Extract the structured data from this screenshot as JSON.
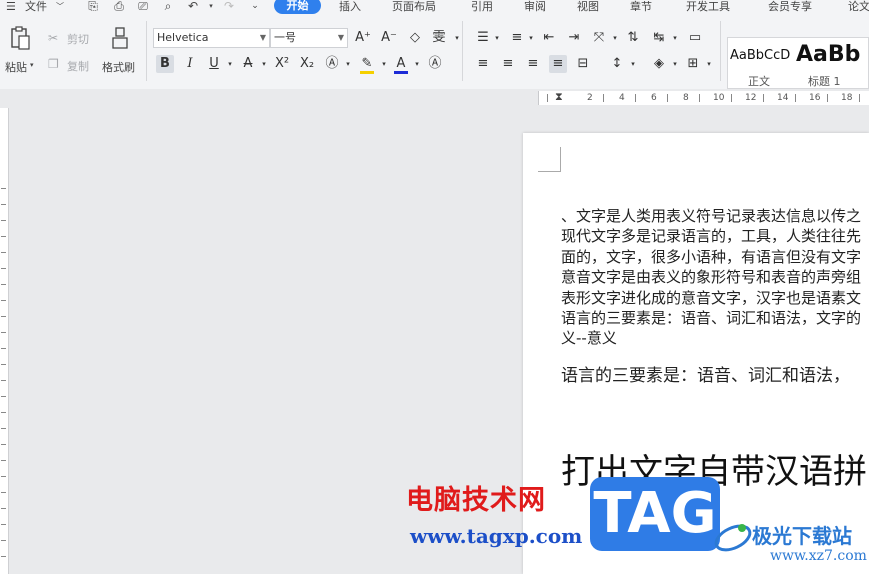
{
  "menu": {
    "file_label": "文件",
    "tabs": [
      {
        "label": "开始",
        "active": true
      },
      {
        "label": "插入"
      },
      {
        "label": "页面布局"
      },
      {
        "label": "引用"
      },
      {
        "label": "审阅"
      },
      {
        "label": "视图"
      },
      {
        "label": "章节"
      },
      {
        "label": "开发工具"
      },
      {
        "label": "会员专享"
      },
      {
        "label": "论文"
      }
    ]
  },
  "ribbon": {
    "paste_label": "粘贴",
    "cut_label": "剪切",
    "copy_label": "复制",
    "format_painter_label": "格式刷",
    "font_name": "Helvetica",
    "font_size": "一号",
    "styles": [
      {
        "preview": "AaBbCcD",
        "label": "正文"
      },
      {
        "preview": "AaBb",
        "label": "标题 1"
      }
    ]
  },
  "ruler": {
    "numbers": [
      "2",
      "4",
      "6",
      "8",
      "10",
      "12",
      "14",
      "16",
      "18"
    ]
  },
  "document": {
    "paragraph_lines": [
      "、文字是人类用表义符号记录表达信息以传之",
      "现代文字多是记录语言的，工具，人类往往先",
      "面的，文字，很多小语种，有语言但没有文字",
      "意音文字是由表义的象形符号和表音的声旁组",
      "表形文字进化成的意音文字，汉字也是语素文",
      "语言的三要素是：语音、词汇和语法，文字的",
      "义--意义"
    ],
    "paragraph2": "语言的三要素是：语音、词汇和语法，",
    "heading": "打出文字自带汉语拼"
  },
  "watermarks": {
    "cn_text": "电脑技术网",
    "url": "www.tagxp.com",
    "tag_logo": "TAG",
    "site_name": "极光下载站",
    "site_url": "www.xz7.com"
  },
  "colors": {
    "accent": "#2f80ed",
    "font_color": "#1d2bd6",
    "highlight": "#f5d000",
    "watermark_red": "#e01b1b",
    "watermark_blue": "#1c4fc8"
  }
}
